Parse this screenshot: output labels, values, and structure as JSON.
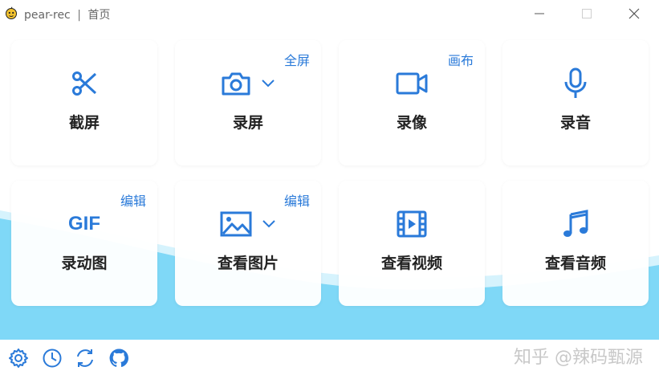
{
  "window": {
    "app_name": "pear-rec",
    "separator": "|",
    "page_name": "首页"
  },
  "cards": [
    {
      "label": "截屏",
      "tag": "",
      "icon": "scissors-icon"
    },
    {
      "label": "录屏",
      "tag": "全屏",
      "icon": "camera-icon"
    },
    {
      "label": "录像",
      "tag": "画布",
      "icon": "video-camera-icon"
    },
    {
      "label": "录音",
      "tag": "",
      "icon": "microphone-icon"
    },
    {
      "label": "录动图",
      "tag": "编辑",
      "icon": "gif-icon"
    },
    {
      "label": "查看图片",
      "tag": "编辑",
      "icon": "image-icon"
    },
    {
      "label": "查看视频",
      "tag": "",
      "icon": "film-icon"
    },
    {
      "label": "查看音频",
      "tag": "",
      "icon": "music-note-icon"
    }
  ],
  "gif_text": "GIF",
  "bottom_icons": [
    "settings-icon",
    "history-icon",
    "refresh-icon",
    "github-icon"
  ],
  "watermark": "知乎 @辣码甄源",
  "colors": {
    "accent": "#2a7ad9",
    "wave": "#7fd8f7",
    "background": "#ffffff"
  }
}
